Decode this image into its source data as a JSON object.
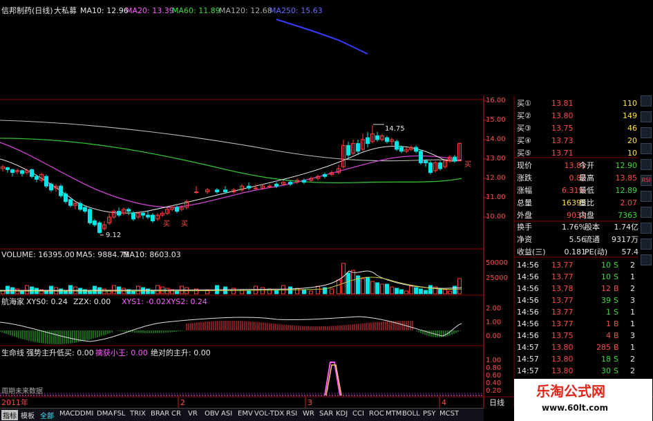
{
  "header": {
    "title": "信邦制药(日线)",
    "formula": "大私募",
    "ma10": "MA10: 12.96",
    "ma20": "MA20: 13.39",
    "ma60": "MA60: 11.89",
    "ma120": "MA120: 12.68",
    "ma250": "MA250: 15.63"
  },
  "price_axis": [
    "16.00",
    "15.00",
    "14.00",
    "13.00",
    "12.00",
    "11.00",
    "10.00"
  ],
  "price_annotations": {
    "high": "14.75",
    "low": "9.12",
    "buy1": "买",
    "buy2": "买",
    "buy3": "买"
  },
  "volume": {
    "label": "VOLUME: 16395.00",
    "ma5": "MA5: 9884.75",
    "ma10": "MA10: 8603.03",
    "axis": [
      "50000",
      "25000"
    ]
  },
  "ind1": {
    "label": "航海家",
    "xys0": "XYS0: 0.24",
    "zzx": "ZZX: 0.00",
    "xys1": "XYS1: -0.02",
    "xys2": "XYS2: 0.24",
    "axis": [
      "2.00",
      "1.00",
      "0.00"
    ]
  },
  "ind2": {
    "label": "生命线",
    "a": "强势主升低买: 0.00",
    "b": "擒获小王: 0.00",
    "c": "绝对的主升: 0.00",
    "axis": [
      "1.00",
      "0.80",
      "0.60",
      "0.40",
      "0.20"
    ],
    "note": "周期未来数据"
  },
  "date_axis": {
    "year": "2011年",
    "m2": "2",
    "m3": "3",
    "m4": "4",
    "period": "日线"
  },
  "bids": [
    {
      "l": "买①",
      "p": "13.81",
      "v": "110"
    },
    {
      "l": "买②",
      "p": "13.80",
      "v": "149"
    },
    {
      "l": "买③",
      "p": "13.75",
      "v": "46"
    },
    {
      "l": "买④",
      "p": "13.73",
      "v": "20"
    },
    {
      "l": "买⑤",
      "p": "13.71",
      "v": "10"
    }
  ],
  "quote": [
    {
      "l1": "现价",
      "v1": "13.81",
      "l2": "今开",
      "v2": "12.90"
    },
    {
      "l1": "涨跌",
      "v1": "0.82",
      "l2": "最高",
      "v2": "13.85"
    },
    {
      "l1": "涨幅",
      "v1": "6.31%",
      "l2": "最低",
      "v2": "12.89"
    },
    {
      "l1": "总量",
      "v1": "16395",
      "l2": "量比",
      "v2": "2.07"
    },
    {
      "l1": "外盘",
      "v1": "9032",
      "l2": "内盘",
      "v2": "7363"
    }
  ],
  "stats": [
    {
      "l1": "换手",
      "v1": "1.76%",
      "l2": "股本",
      "v2": "1.74亿"
    },
    {
      "l1": "净资",
      "v1": "5.56",
      "l2": "流通",
      "v2": "9317万"
    },
    {
      "l1": "收益(三)",
      "v1": "0.181",
      "l2": "PE(动)",
      "v2": "57.4"
    }
  ],
  "ticks": [
    {
      "t": "14:56",
      "p": "13.77",
      "v": "10",
      "s": "S",
      "n": "2"
    },
    {
      "t": "14:56",
      "p": "13.77",
      "v": "10",
      "s": "S",
      "n": "1"
    },
    {
      "t": "14:56",
      "p": "13.78",
      "v": "12",
      "s": "B",
      "n": "2"
    },
    {
      "t": "14:56",
      "p": "13.77",
      "v": "39",
      "s": "S",
      "n": "3"
    },
    {
      "t": "14:56",
      "p": "13.77",
      "v": "1",
      "s": "S",
      "n": "1"
    },
    {
      "t": "14:56",
      "p": "13.77",
      "v": "1",
      "s": "B",
      "n": "1"
    },
    {
      "t": "14:56",
      "p": "13.75",
      "v": "4",
      "s": "B",
      "n": "3"
    },
    {
      "t": "14:57",
      "p": "13.80",
      "v": "285",
      "s": "B",
      "n": "1"
    },
    {
      "t": "14:57",
      "p": "13.80",
      "v": "18",
      "s": "S",
      "n": "2"
    },
    {
      "t": "14:57",
      "p": "13.80",
      "v": "30",
      "s": "S",
      "n": "2"
    }
  ],
  "tabs": [
    "指标",
    "模板",
    "全部",
    "MACD",
    "DMI",
    "DMA",
    "FSL",
    "TRIX",
    "BRAR",
    "CR",
    "VR",
    "OBV",
    "ASI",
    "EMV",
    "VOL-TDX",
    "RSI",
    "WR",
    "SAR",
    "KDJ",
    "CCI",
    "ROC",
    "MTM",
    "BOLL",
    "PSY",
    "MCST"
  ],
  "watermark": {
    "line1": "乐淘公式网",
    "line2": "www.60lt.com"
  },
  "right_tools": [
    "",
    "",
    "",
    "",
    "",
    "RSI",
    "",
    "",
    "",
    "",
    ""
  ],
  "colors": {
    "up": "#ff3c3c",
    "down": "#00e5e5",
    "ma10": "#e8e8e8",
    "ma20": "#d040d0",
    "ma60": "#30c030",
    "ma250": "#3a3aff"
  }
}
